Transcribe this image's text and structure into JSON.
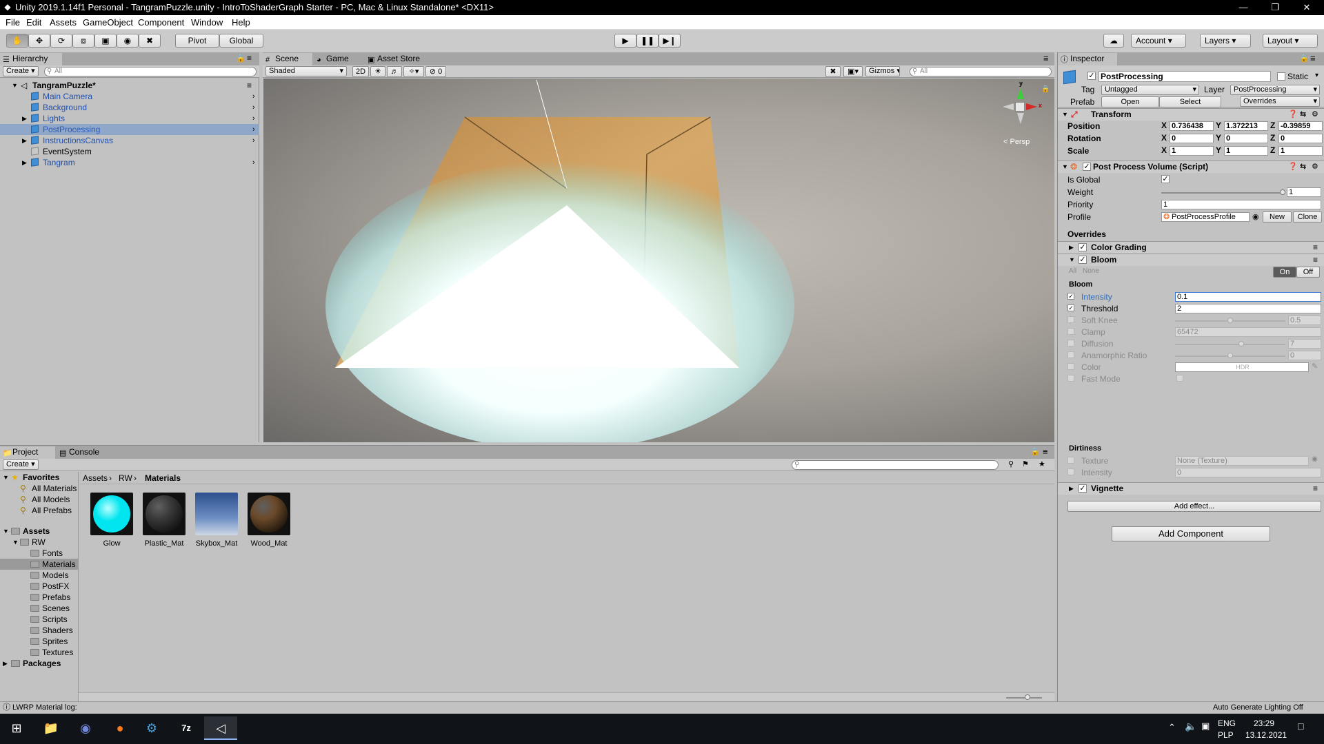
{
  "window": {
    "title": "Unity 2019.1.14f1 Personal - TangramPuzzle.unity - IntroToShaderGraph Starter - PC, Mac & Linux Standalone* <DX11>"
  },
  "menu": [
    "File",
    "Edit",
    "Assets",
    "GameObject",
    "Component",
    "Window",
    "Help"
  ],
  "toolbar": {
    "pivot": "Pivot",
    "global": "Global",
    "account": "Account",
    "layers": "Layers",
    "layout": "Layout"
  },
  "hierarchy": {
    "tab": "Hierarchy",
    "create": "Create",
    "search_placeholder": "All",
    "scene": "TangramPuzzle*",
    "items": [
      {
        "label": "Main Camera",
        "icon": "cube-icon"
      },
      {
        "label": "Background",
        "icon": "cube-icon"
      },
      {
        "label": "Lights",
        "icon": "cube-icon"
      },
      {
        "label": "PostProcessing",
        "icon": "cube-icon",
        "selected": true
      },
      {
        "label": "InstructionsCanvas",
        "icon": "cube-icon"
      },
      {
        "label": "EventSystem",
        "icon": "cube-grey-icon"
      },
      {
        "label": "Tangram",
        "icon": "cube-icon"
      }
    ]
  },
  "scene": {
    "tabs": [
      "Scene",
      "Game",
      "Asset Store"
    ],
    "shading": "Shaded",
    "mode2d": "2D",
    "fx_count": "0",
    "gizmos": "Gizmos",
    "search_placeholder": "All",
    "persp": "< Persp"
  },
  "inspector": {
    "tab": "Inspector",
    "object_name": "PostProcessing",
    "static": "Static",
    "tag_label": "Tag",
    "tag": "Untagged",
    "layer_label": "Layer",
    "layer": "PostProcessing",
    "prefab_label": "Prefab",
    "open": "Open",
    "select": "Select",
    "overrides": "Overrides",
    "transform": {
      "title": "Transform",
      "position": "Position",
      "rotation": "Rotation",
      "scale": "Scale",
      "pos": [
        "0.736438",
        "1.372213",
        "-0.39859"
      ],
      "rot": [
        "0",
        "0",
        "0"
      ],
      "scl": [
        "1",
        "1",
        "1"
      ]
    },
    "ppv": {
      "title": "Post Process Volume (Script)",
      "is_global": "Is Global",
      "weight": "Weight",
      "weight_val": "1",
      "weight_level": 1.0,
      "priority": "Priority",
      "priority_val": "1",
      "profile": "Profile",
      "profile_val": "PostProcessProfile",
      "new": "New",
      "clone": "Clone"
    },
    "color_grading": "Color Grading",
    "bloom": "Bloom",
    "all": "All",
    "none": "None",
    "on": "On",
    "off": "Off",
    "bloom_section": "Bloom",
    "bloom_fields": [
      {
        "label": "Intensity",
        "value": "0.1",
        "enabled": true,
        "kind": "field"
      },
      {
        "label": "Threshold",
        "value": "2",
        "enabled": true,
        "kind": "field"
      },
      {
        "label": "Soft Knee",
        "value": "0.5",
        "enabled": false,
        "kind": "slider",
        "level": 0.5
      },
      {
        "label": "Clamp",
        "value": "65472",
        "enabled": false,
        "kind": "field"
      },
      {
        "label": "Diffusion",
        "value": "7",
        "enabled": false,
        "kind": "slider",
        "level": 0.6
      },
      {
        "label": "Anamorphic Ratio",
        "value": "0",
        "enabled": false,
        "kind": "slider",
        "level": 0.5
      },
      {
        "label": "Color",
        "value": "HDR",
        "enabled": false,
        "kind": "color"
      },
      {
        "label": "Fast Mode",
        "value": "",
        "enabled": false,
        "kind": "check"
      }
    ],
    "dirtiness": "Dirtiness",
    "dirt_fields": [
      {
        "label": "Texture",
        "value": "None (Texture)"
      },
      {
        "label": "Intensity",
        "value": "0"
      }
    ],
    "vignette": "Vignette",
    "add_effect": "Add effect...",
    "add_component": "Add Component"
  },
  "project": {
    "tabs": [
      "Project",
      "Console"
    ],
    "create": "Create",
    "favorites": "Favorites",
    "fav_items": [
      "All Materials",
      "All Models",
      "All Prefabs"
    ],
    "assets": "Assets",
    "rw": "RW",
    "folders": [
      "Fonts",
      "Materials",
      "Models",
      "PostFX",
      "Prefabs",
      "Scenes",
      "Scripts",
      "Shaders",
      "Sprites",
      "Textures"
    ],
    "packages": "Packages",
    "breadcrumb": [
      "Assets",
      "RW",
      "Materials"
    ],
    "materials": [
      {
        "name": "Glow",
        "color": "#00e5ef"
      },
      {
        "name": "Plastic_Mat",
        "color": "#3a3a3a"
      },
      {
        "name": "Skybox_Mat",
        "color": "#4a72b5"
      },
      {
        "name": "Wood_Mat",
        "color": "#6b4a2a"
      }
    ]
  },
  "status": {
    "left": "LWRP Material log:",
    "right": "Auto Generate Lighting Off"
  },
  "taskbar": {
    "lang1": "ENG",
    "lang2": "PLP",
    "time": "23:29",
    "date": "13.12.2021"
  }
}
